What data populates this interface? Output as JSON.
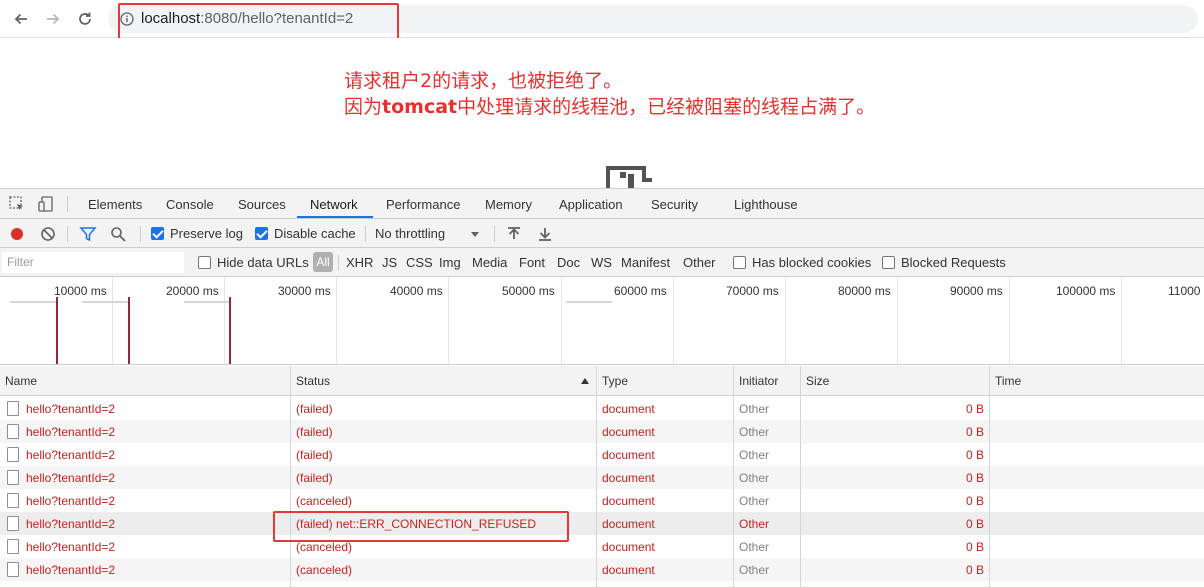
{
  "browser": {
    "url_host": "localhost",
    "url_rest": ":8080/hello?tenantId=2"
  },
  "annotation": {
    "line1": "请求租户2的请求，也被拒绝了。",
    "line2_prefix": "因为",
    "line2_bold": "tomcat",
    "line2_suffix": "中处理请求的线程池，已经被阻塞的线程占满了。"
  },
  "devtools": {
    "tabs": [
      "Elements",
      "Console",
      "Sources",
      "Network",
      "Performance",
      "Memory",
      "Application",
      "Security",
      "Lighthouse"
    ],
    "active_tab": "Network",
    "toolbar": {
      "preserve_log": "Preserve log",
      "disable_cache": "Disable cache",
      "throttling": "No throttling"
    },
    "filter": {
      "placeholder": "Filter",
      "hide_data_urls": "Hide data URLs",
      "all": "All",
      "types": [
        "XHR",
        "JS",
        "CSS",
        "Img",
        "Media",
        "Font",
        "Doc",
        "WS",
        "Manifest",
        "Other"
      ],
      "has_blocked_cookies": "Has blocked cookies",
      "blocked_requests": "Blocked Requests"
    },
    "overview_labels": [
      "10000 ms",
      "20000 ms",
      "30000 ms",
      "40000 ms",
      "50000 ms",
      "60000 ms",
      "70000 ms",
      "80000 ms",
      "90000 ms",
      "100000 ms",
      "11000"
    ],
    "columns": [
      "Name",
      "Status",
      "Type",
      "Initiator",
      "Size",
      "Time"
    ],
    "rows": [
      {
        "name": "hello?tenantId=2",
        "status": "(failed)",
        "type": "document",
        "initiator": "Other",
        "size": "0 B"
      },
      {
        "name": "hello?tenantId=2",
        "status": "(failed)",
        "type": "document",
        "initiator": "Other",
        "size": "0 B"
      },
      {
        "name": "hello?tenantId=2",
        "status": "(failed)",
        "type": "document",
        "initiator": "Other",
        "size": "0 B"
      },
      {
        "name": "hello?tenantId=2",
        "status": "(failed)",
        "type": "document",
        "initiator": "Other",
        "size": "0 B"
      },
      {
        "name": "hello?tenantId=2",
        "status": "(canceled)",
        "type": "document",
        "initiator": "Other",
        "size": "0 B"
      },
      {
        "name": "hello?tenantId=2",
        "status": "(failed) net::ERR_CONNECTION_REFUSED",
        "type": "document",
        "initiator": "Other",
        "size": "0 B"
      },
      {
        "name": "hello?tenantId=2",
        "status": "(canceled)",
        "type": "document",
        "initiator": "Other",
        "size": "0 B"
      },
      {
        "name": "hello?tenantId=2",
        "status": "(canceled)",
        "type": "document",
        "initiator": "Other",
        "size": "0 B"
      }
    ]
  },
  "colors": {
    "error_red": "#c5221f",
    "annotation_red": "#e8312f",
    "accent_blue": "#1a73e8"
  }
}
